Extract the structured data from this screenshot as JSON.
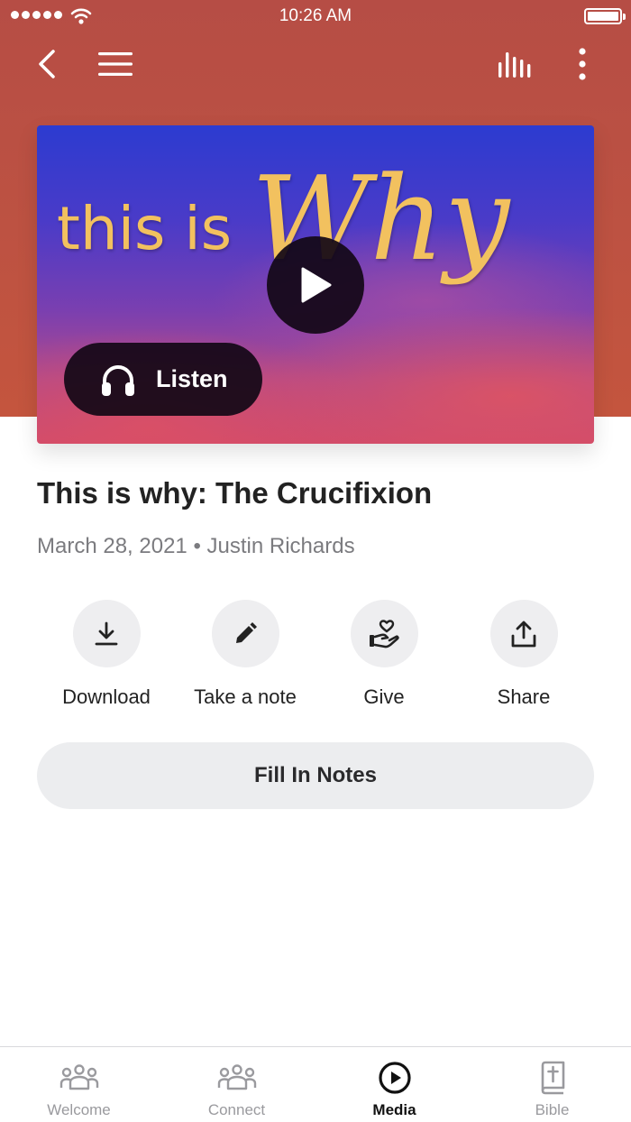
{
  "status_bar": {
    "time": "10:26 AM"
  },
  "hero": {
    "artwork_text_1": "this is",
    "artwork_text_2": "Why",
    "listen_label": "Listen"
  },
  "sermon": {
    "title": "This is why: The Crucifixion",
    "meta": "March 28, 2021 • Justin Richards"
  },
  "actions": [
    {
      "label": "Download",
      "icon": "download-icon"
    },
    {
      "label": "Take a note",
      "icon": "pencil-icon"
    },
    {
      "label": "Give",
      "icon": "give-heart-hand-icon"
    },
    {
      "label": "Share",
      "icon": "share-icon"
    }
  ],
  "fill_in_notes_label": "Fill In Notes",
  "tabs": [
    {
      "label": "Welcome",
      "icon": "people-group-icon",
      "active": false
    },
    {
      "label": "Connect",
      "icon": "people-group-icon",
      "active": false
    },
    {
      "label": "Media",
      "icon": "play-circle-icon",
      "active": true
    },
    {
      "label": "Bible",
      "icon": "bible-book-icon",
      "active": false
    }
  ],
  "colors": {
    "header": "#bd5242",
    "text_primary": "#222222",
    "text_secondary": "#7b7b7f",
    "artwork_text": "#f2c15f"
  }
}
